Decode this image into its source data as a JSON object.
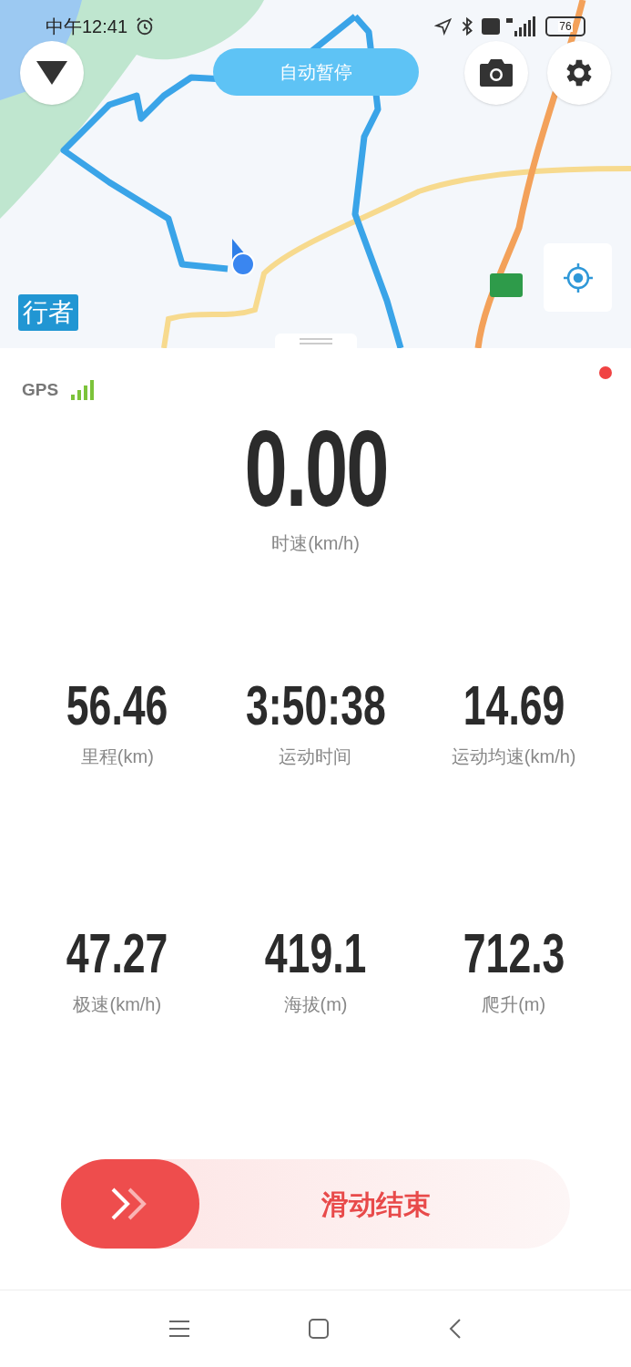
{
  "status_bar": {
    "time": "中午12:41",
    "battery": "76"
  },
  "map": {
    "auto_pause_button": "自动暂停",
    "brand_badge": "行者"
  },
  "gps": {
    "label": "GPS",
    "recording": true
  },
  "speed": {
    "value": "0.00",
    "label": "时速(km/h)"
  },
  "stats": [
    {
      "value": "56.46",
      "label": "里程(km)"
    },
    {
      "value": "3:50:38",
      "label": "运动时间"
    },
    {
      "value": "14.69",
      "label": "运动均速(km/h)"
    },
    {
      "value": "47.27",
      "label": "极速(km/h)"
    },
    {
      "value": "419.1",
      "label": "海拔(m)"
    },
    {
      "value": "712.3",
      "label": "爬升(m)"
    }
  ],
  "slide_button": {
    "label": "滑动结束"
  }
}
